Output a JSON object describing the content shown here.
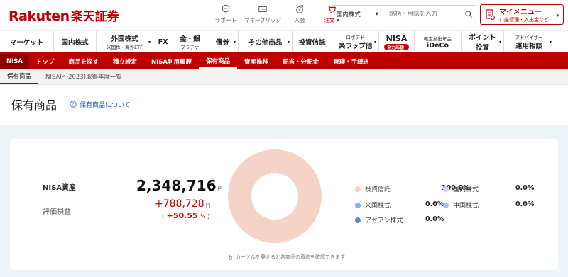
{
  "header": {
    "logo_en": "Rakuten",
    "logo_jp": "楽天証券",
    "utils": [
      {
        "label": "サポート",
        "icon": "support-icon"
      },
      {
        "label": "マネーブリッジ",
        "icon": "bank-icon"
      },
      {
        "label": "入金",
        "icon": "deposit-icon"
      },
      {
        "label": "注文",
        "icon": "cart-icon"
      }
    ],
    "search": {
      "select": "国内株式",
      "placeholder": "銘柄・用語を入力"
    },
    "mymenu": {
      "title": "マイメニュー",
      "subtitle": "口座管理・入出金など"
    }
  },
  "mainnav": [
    {
      "label": "マーケット",
      "sub": ""
    },
    {
      "label": "国内株式",
      "sub": ""
    },
    {
      "label": "外国株式",
      "sub": "米国株・海外ETF"
    },
    {
      "label": "FX",
      "sub": ""
    },
    {
      "label": "金・銀",
      "sub": "プラチナ"
    },
    {
      "label": "債券",
      "sub": ""
    },
    {
      "label": "その他商品",
      "sub": ""
    },
    {
      "label": "投資信託",
      "sub": ""
    },
    {
      "label": "ロボアド",
      "sub": "楽ラップ他"
    },
    {
      "label": "NISA",
      "sub": "全力応援!"
    },
    {
      "label": "確定拠出年金",
      "sub": "iDeCo"
    },
    {
      "label": "ポイント",
      "sub": "投資"
    },
    {
      "label": "アドバイザー",
      "sub": "運用相談"
    }
  ],
  "subnav": [
    "NISA",
    "トップ",
    "商品を探す",
    "積立設定",
    "NISA利用履歴",
    "保有商品",
    "資産推移",
    "配当・分配金",
    "管理・手続き"
  ],
  "tertiary": [
    "保有商品",
    "NISA(〜2023)取得年度一覧"
  ],
  "page": {
    "title": "保有商品",
    "help": "保有商品について"
  },
  "summary": {
    "asset_label": "NISA資産",
    "asset_value": "2,348,716",
    "unit": "円",
    "pl_label": "評価損益",
    "pl_value": "+788,728",
    "pl_pct": "+50.55",
    "pct_open": "(",
    "pct_unit": "%",
    "pct_close": ")"
  },
  "chart_data": {
    "type": "pie",
    "categories": [
      "投資信託",
      "国内株式",
      "米国株式",
      "中国株式",
      "アセアン株式"
    ],
    "values": [
      100.0,
      0.0,
      0.0,
      0.0,
      0.0
    ],
    "labels": [
      "100.0%",
      "0.0%",
      "0.0%",
      "0.0%",
      "0.0%"
    ],
    "colors": [
      "#f6d3c7",
      "#c9d6f2",
      "#8fb0ea",
      "#a9c0ef",
      "#5b86d9"
    ],
    "hint": "カーソルを乗せると各商品の資産を確認できます"
  }
}
